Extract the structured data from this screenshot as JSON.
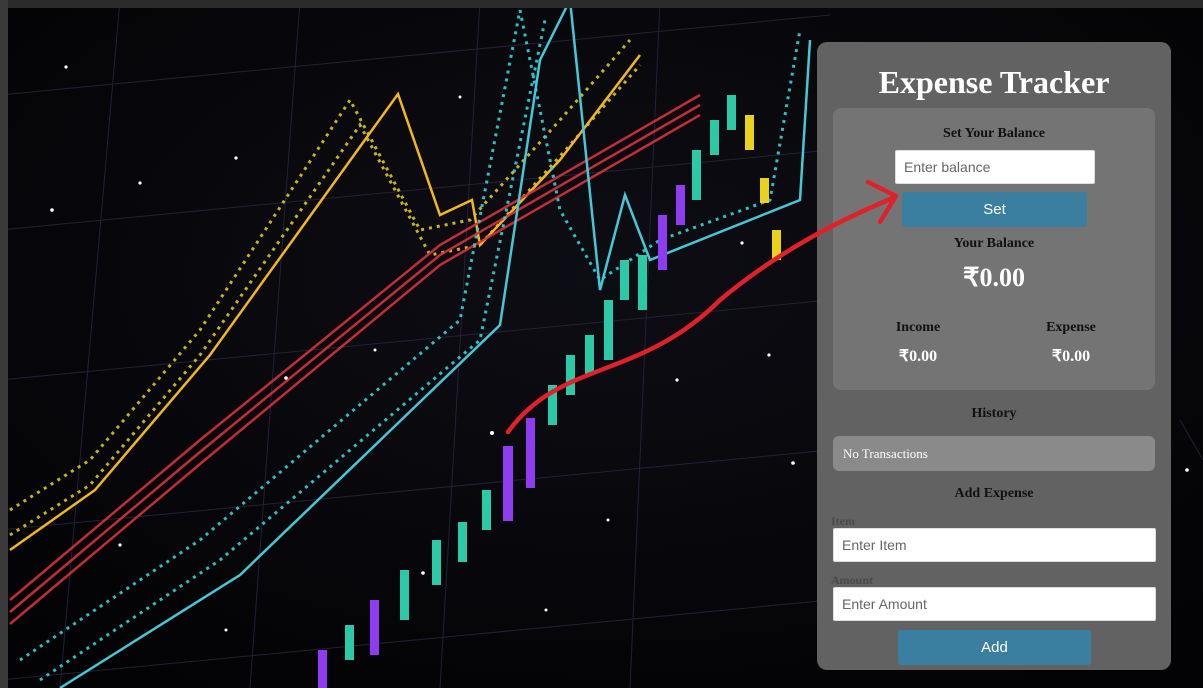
{
  "app": {
    "title": "Expense Tracker"
  },
  "balance_section": {
    "heading": "Set Your Balance",
    "input_placeholder": "Enter balance",
    "set_button_label": "Set",
    "your_balance_label": "Your Balance",
    "balance_value": "₹0.00",
    "income_label": "Income",
    "income_value": "₹0.00",
    "expense_label": "Expense",
    "expense_value": "₹0.00"
  },
  "history": {
    "heading": "History",
    "empty_text": "No Transactions"
  },
  "add_expense": {
    "heading": "Add Expense",
    "item_label": "Item",
    "item_placeholder": "Enter Item",
    "amount_label": "Amount",
    "amount_placeholder": "Enter Amount",
    "add_button_label": "Add"
  },
  "colors": {
    "panel_bg": "#696969",
    "button_accent": "#3a7f9f",
    "annotation_arrow": "#e0202a"
  }
}
